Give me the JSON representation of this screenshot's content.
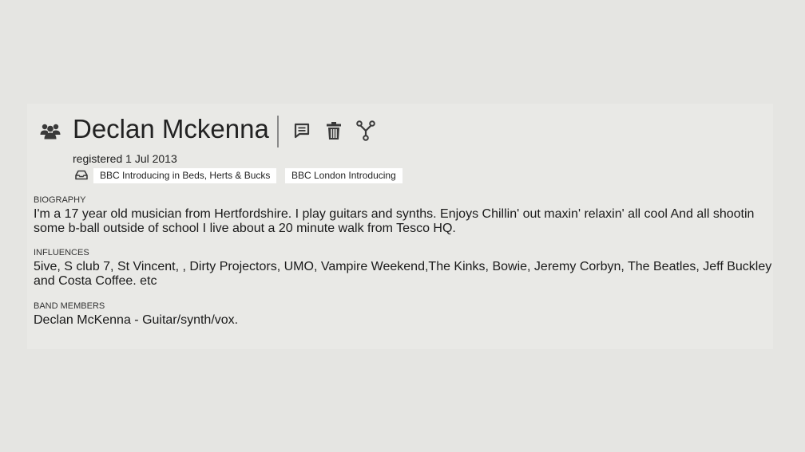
{
  "artist": {
    "name": "Declan Mckenna",
    "registered": "registered 1 Jul 2013"
  },
  "icons": {
    "group": "group-icon",
    "comment": "comment-icon",
    "delete": "trash-icon",
    "merge": "merge-icon",
    "tray": "inbox-tray-icon"
  },
  "tags": [
    "BBC Introducing in Beds, Herts & Bucks",
    "BBC London Introducing"
  ],
  "sections": {
    "biography": {
      "label": "BIOGRAPHY",
      "text": "I'm a 17 year old musician from Hertfordshire. I play guitars and synths.  Enjoys Chillin' out maxin' relaxin' all cool And all shootin some b-ball outside of school  I live about a 20 minute walk from Tesco HQ."
    },
    "influences": {
      "label": "INFLUENCES",
      "text": "5ive, S club 7, St Vincent, , Dirty Projectors, UMO, Vampire Weekend,The Kinks, Bowie, Jeremy Corbyn, The Beatles, Jeff Buckley and Costa Coffee. etc"
    },
    "band_members": {
      "label": "BAND MEMBERS",
      "text": "Declan McKenna - Guitar/synth/vox."
    }
  },
  "colors": {
    "background": "#e5e5e2",
    "panel": "#e9e9e6",
    "icon": "#3a3a3a",
    "tag_background": "#ffffff"
  }
}
